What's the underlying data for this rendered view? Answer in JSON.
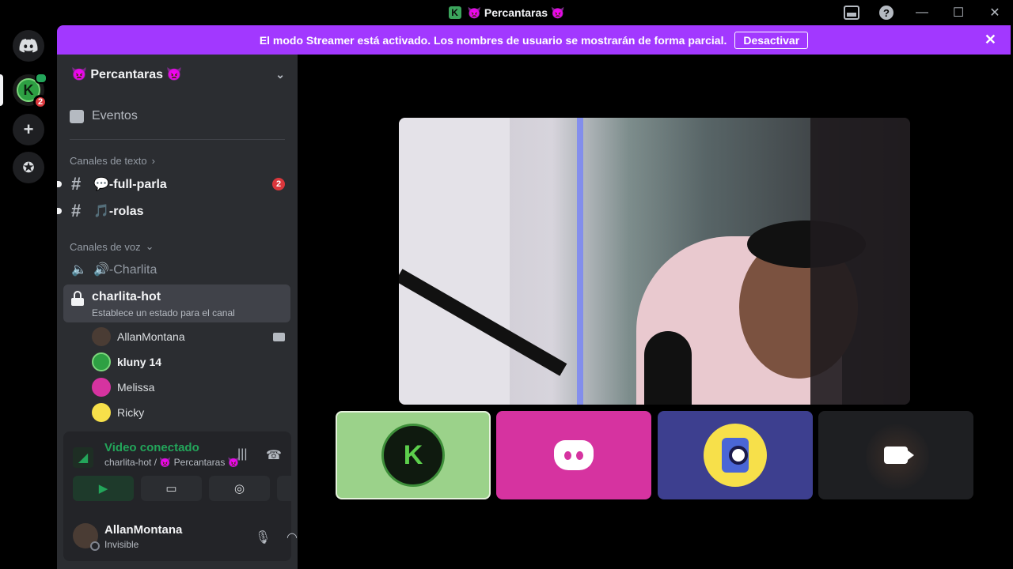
{
  "window": {
    "title": "👿 Percantaras 👿"
  },
  "streamer_bar": {
    "message": "El modo Streamer está activado. Los nombres de usuario se mostrarán de forma parcial.",
    "button": "Desactivar"
  },
  "guilds": {
    "server_badge": "2"
  },
  "sidebar": {
    "server_name": "👿 Percantaras 👿",
    "events_label": "Eventos",
    "text_category": "Canales de texto",
    "voice_category": "Canales de voz",
    "text_channels": [
      {
        "name": "💬-full-parla",
        "badge": "2"
      },
      {
        "name": "🎵-rolas"
      }
    ],
    "voice_channels": [
      {
        "name": "🔊-Charlita"
      }
    ],
    "active_voice": {
      "name": "charlita-hot",
      "status": "Establece un estado para el canal"
    },
    "voice_users": [
      {
        "name": "AllanMontana"
      },
      {
        "name": "kluny 14"
      },
      {
        "name": "Melissa"
      },
      {
        "name": "Ricky"
      }
    ]
  },
  "panel": {
    "connection_title": "Video conectado",
    "connection_sub": "charlita-hot / 👿 Percantaras 👿",
    "user_name": "AllanMontana",
    "user_status": "Invisible"
  },
  "tiles": {
    "k_label": "K"
  },
  "colors": {
    "accent_purple": "#a238ff",
    "green": "#23a55a",
    "red_badge": "#da373c",
    "tile_green": "#9bd28a",
    "tile_pink": "#d633a0",
    "tile_blue": "#3d3f8f"
  }
}
